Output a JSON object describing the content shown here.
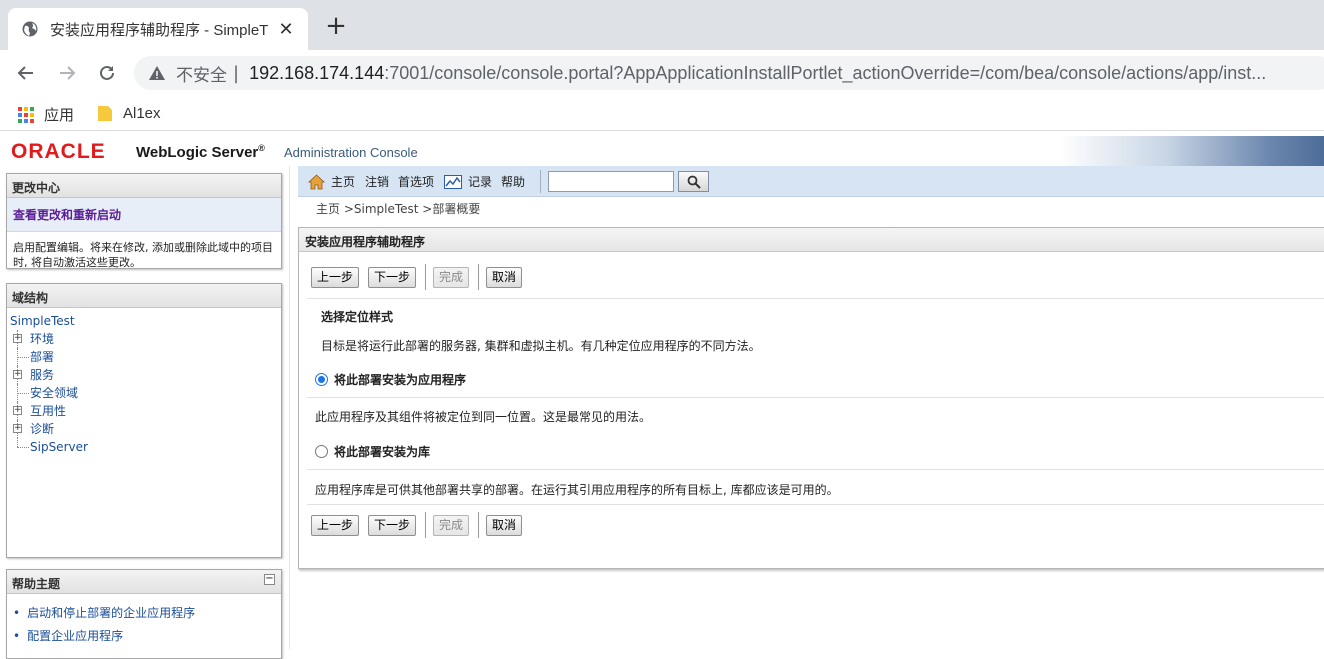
{
  "browser": {
    "tab_title": "安装应用程序辅助程序 - SimpleT",
    "tab_close": "✕",
    "new_tab": "+",
    "security_label": "不安全",
    "url_host": "192.168.174.144",
    "url_rest": ":7001/console/console.portal?AppApplicationInstallPortlet_actionOverride=/com/bea/console/actions/app/inst...",
    "bookmarks": [
      {
        "label": "应用",
        "icon": "apps-grid-icon"
      },
      {
        "label": "Al1ex",
        "icon": "folder-icon"
      }
    ]
  },
  "header": {
    "oracle": "ORACLE",
    "product": "WebLogic Server",
    "reg": "®",
    "console": "Administration Console"
  },
  "change_center": {
    "title": "更改中心",
    "link": "查看更改和重新启动",
    "text": "启用配置编辑。将来在修改, 添加或删除此域中的项目时, 将自动激活这些更改。"
  },
  "domain_structure": {
    "title": "域结构",
    "root": "SimpleTest",
    "nodes": [
      {
        "label": "环境",
        "expandable": true
      },
      {
        "label": "部署",
        "expandable": false
      },
      {
        "label": "服务",
        "expandable": true
      },
      {
        "label": "安全领域",
        "expandable": false
      },
      {
        "label": "互用性",
        "expandable": true
      },
      {
        "label": "诊断",
        "expandable": true
      },
      {
        "label": "SipServer",
        "expandable": false
      }
    ],
    "expand_glyph": "+"
  },
  "help_topics": {
    "title": "帮助主题",
    "collapse_glyph": "−",
    "items": [
      "启动和停止部署的企业应用程序",
      "配置企业应用程序"
    ]
  },
  "command_bar": {
    "home": "主页",
    "logout": "注销",
    "preferences": "首选项",
    "record": "记录",
    "help": "帮助",
    "search_value": ""
  },
  "breadcrumb": "主页 >SimpleTest >部署概要",
  "assistant": {
    "title": "安装应用程序辅助程序",
    "buttons": {
      "back": "上一步",
      "next": "下一步",
      "finish": "完成",
      "cancel": "取消"
    },
    "section_title": "选择定位样式",
    "intro": "目标是将运行此部署的服务器, 集群和虚拟主机。有几种定位应用程序的不同方法。",
    "option_app": "将此部署安装为应用程序",
    "option_app_desc": "此应用程序及其组件将被定位到同一位置。这是最常见的用法。",
    "option_lib": "将此部署安装为库",
    "option_lib_desc": "应用程序库是可供其他部署共享的部署。在运行其引用应用程序的所有目标上, 库都应该是可用的。",
    "selected": "app"
  }
}
